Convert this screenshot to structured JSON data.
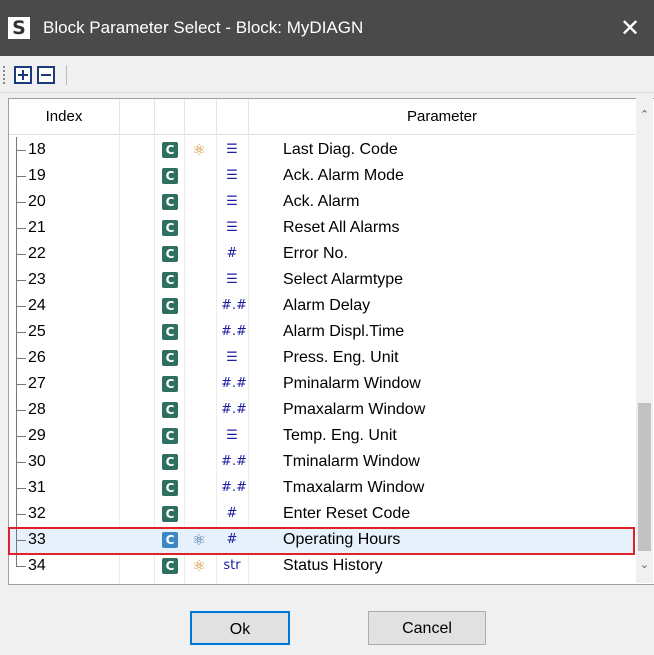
{
  "window": {
    "app_icon": "S",
    "title": "Block Parameter Select - Block: MyDIAGN",
    "close_glyph": "✕"
  },
  "toolbar": {
    "expand_icon": "expand-all-icon",
    "collapse_icon": "collapse-all-icon"
  },
  "columns": {
    "index": "Index",
    "parameter": "Parameter"
  },
  "rows": [
    {
      "index": "18",
      "c": "C",
      "atom": "⚛",
      "type": "☰",
      "parameter": "Last Diag. Code"
    },
    {
      "index": "19",
      "c": "C",
      "atom": "",
      "type": "☰",
      "parameter": "Ack. Alarm Mode"
    },
    {
      "index": "20",
      "c": "C",
      "atom": "",
      "type": "☰",
      "parameter": "Ack. Alarm"
    },
    {
      "index": "21",
      "c": "C",
      "atom": "",
      "type": "☰",
      "parameter": "Reset All Alarms"
    },
    {
      "index": "22",
      "c": "C",
      "atom": "",
      "type": "#",
      "parameter": "Error No."
    },
    {
      "index": "23",
      "c": "C",
      "atom": "",
      "type": "☰",
      "parameter": "Select Alarmtype"
    },
    {
      "index": "24",
      "c": "C",
      "atom": "",
      "type": "#.#",
      "parameter": "Alarm Delay"
    },
    {
      "index": "25",
      "c": "C",
      "atom": "",
      "type": "#.#",
      "parameter": "Alarm Displ.Time"
    },
    {
      "index": "26",
      "c": "C",
      "atom": "",
      "type": "☰",
      "parameter": "Press. Eng. Unit"
    },
    {
      "index": "27",
      "c": "C",
      "atom": "",
      "type": "#.#",
      "parameter": "Pminalarm Window"
    },
    {
      "index": "28",
      "c": "C",
      "atom": "",
      "type": "#.#",
      "parameter": "Pmaxalarm Window"
    },
    {
      "index": "29",
      "c": "C",
      "atom": "",
      "type": "☰",
      "parameter": "Temp. Eng. Unit"
    },
    {
      "index": "30",
      "c": "C",
      "atom": "",
      "type": "#.#",
      "parameter": "Tminalarm Window"
    },
    {
      "index": "31",
      "c": "C",
      "atom": "",
      "type": "#.#",
      "parameter": "Tmaxalarm Window"
    },
    {
      "index": "32",
      "c": "C",
      "atom": "",
      "type": "#",
      "parameter": "Enter Reset Code"
    },
    {
      "index": "33",
      "c": "C",
      "atom": "⚛",
      "type": "#",
      "parameter": "Operating Hours",
      "selected": true
    },
    {
      "index": "34",
      "c": "C",
      "atom": "⚛",
      "type": "str",
      "parameter": "Status History"
    }
  ],
  "buttons": {
    "ok": "Ok",
    "cancel": "Cancel"
  },
  "colors": {
    "titlebar": "#4a4a4a",
    "c_badge": "#2f6f5f",
    "selection": "#e6f1fb",
    "highlight_box": "#e0202a"
  }
}
